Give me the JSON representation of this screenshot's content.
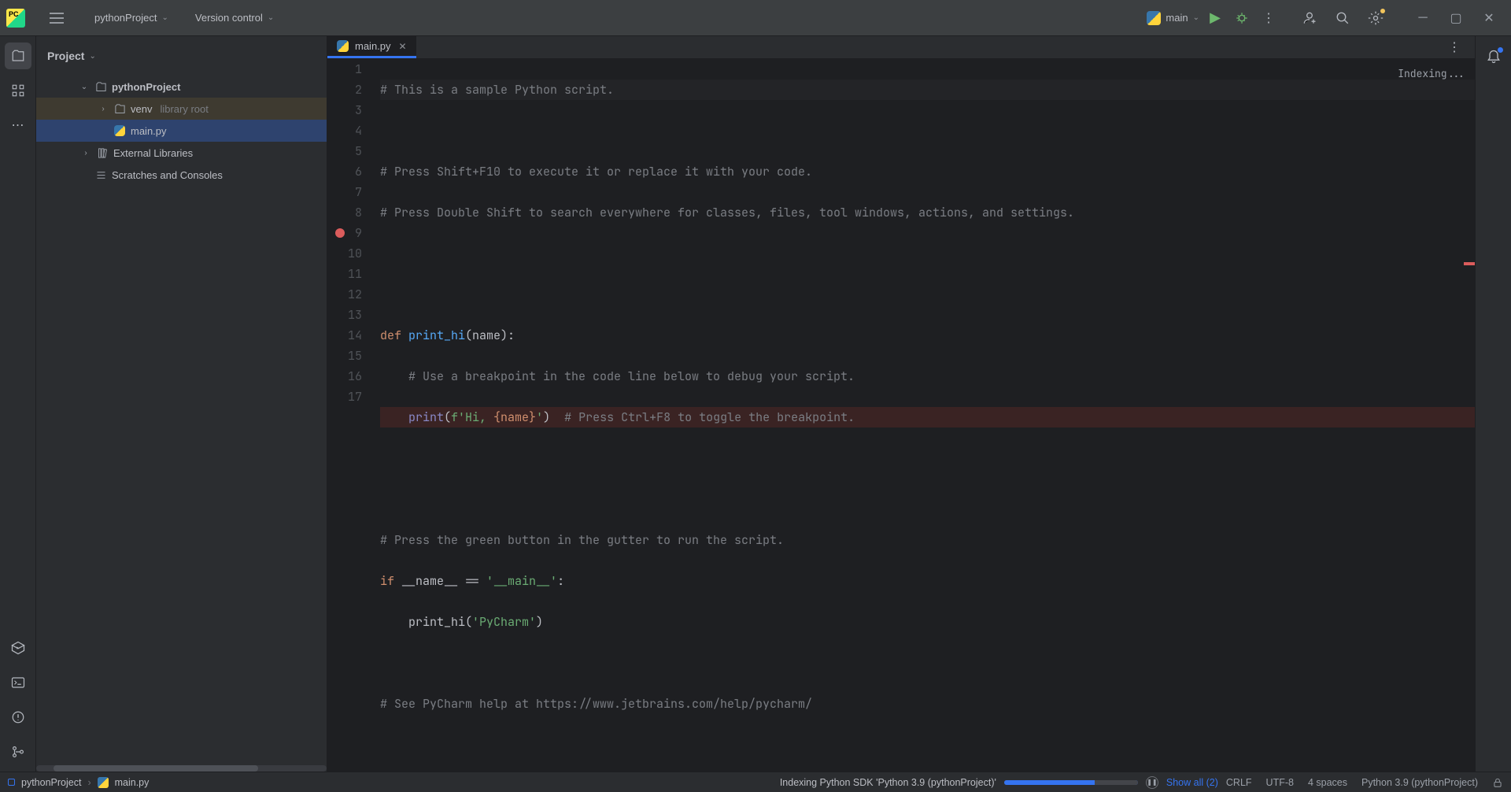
{
  "titlebar": {
    "project_name": "pythonProject",
    "vcs_label": "Version control",
    "run_config": "main"
  },
  "project_panel": {
    "title": "Project",
    "tree": {
      "root": "pythonProject",
      "venv": {
        "name": "venv",
        "tag": "library root"
      },
      "main_file": "main.py",
      "external_libs": "External Libraries",
      "scratches": "Scratches and Consoles"
    }
  },
  "editor": {
    "tab_name": "main.py",
    "indexing_hint": "Indexing...",
    "breakpoint_line": 9,
    "code_lines": {
      "l1": "# This is a sample Python script.",
      "l3": "# Press Shift+F10 to execute it or replace it with your code.",
      "l4": "# Press Double Shift to search everywhere for classes, files, tool windows, actions, and settings.",
      "l7_def": "def ",
      "l7_fn": "print_hi",
      "l7_rest": "(name):",
      "l8": "    # Use a breakpoint in the code line below to debug your script.",
      "l9_print": "    print",
      "l9_open": "(",
      "l9_f": "f'Hi, ",
      "l9_brace": "{name}",
      "l9_end": "'",
      "l9_close": ")",
      "l9_comment": "  # Press Ctrl+F8 to toggle the breakpoint.",
      "l12": "# Press the green button in the gutter to run the script.",
      "l13_if": "if ",
      "l13_name": "__name__ ",
      "l13_eq": "== ",
      "l13_str": "'__main__'",
      "l13_colon": ":",
      "l14_call": "    print_hi(",
      "l14_arg": "'PyCharm'",
      "l14_close": ")",
      "l16": "# See PyCharm help at https://www.jetbrains.com/help/pycharm/"
    },
    "line_numbers": [
      "1",
      "2",
      "3",
      "4",
      "5",
      "6",
      "7",
      "8",
      "9",
      "10",
      "11",
      "12",
      "13",
      "14",
      "15",
      "16",
      "17"
    ]
  },
  "statusbar": {
    "breadcrumb_project": "pythonProject",
    "breadcrumb_file": "main.py",
    "indexing_text": "Indexing Python SDK 'Python 3.9 (pythonProject)'",
    "show_all": "Show all (2)",
    "line_sep": "CRLF",
    "encoding": "UTF-8",
    "indent": "4 spaces",
    "interpreter": "Python 3.9 (pythonProject)"
  }
}
